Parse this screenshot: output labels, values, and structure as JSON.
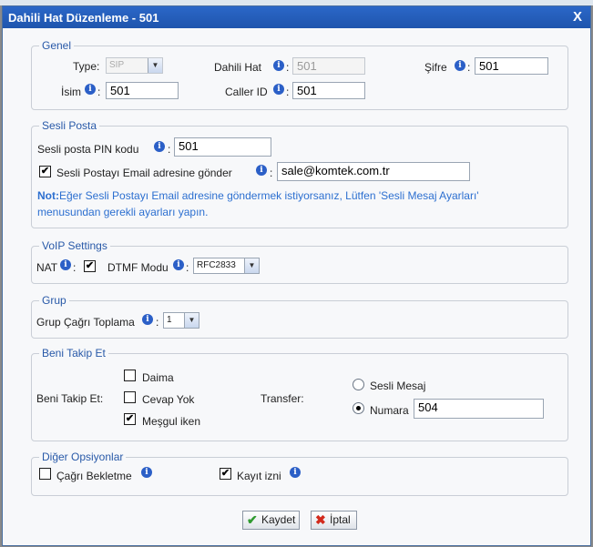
{
  "dialog": {
    "title": "Dahili Hat Düzenleme - 501",
    "close": "X"
  },
  "general": {
    "legend": "Genel",
    "type_label": "Type:",
    "type_value": "SIP",
    "extension_label": "Dahili Hat",
    "extension_value": "501",
    "password_label": "Şifre",
    "password_value": "501",
    "name_label": "İsim",
    "name_value": "501",
    "caller_id_label": "Caller ID",
    "caller_id_value": "501"
  },
  "voicemail": {
    "legend": "Sesli Posta",
    "pin_label": "Sesli posta PIN kodu",
    "pin_value": "501",
    "email_checkbox_label": "Sesli Postayı Email adresine gönder",
    "email_checked": true,
    "email_value": "sale@komtek.com.tr",
    "note_prefix": "Not:",
    "note_line1": "Eğer Sesli Postayı Email adresine göndermek istiyorsanız, Lütfen 'Sesli Mesaj Ayarları'",
    "note_line2": "menusundan gerekli ayarları yapın."
  },
  "voip": {
    "legend": "VoIP Settings",
    "nat_label": "NAT",
    "nat_checked": true,
    "dtmf_label": "DTMF Modu",
    "dtmf_value": "RFC2833"
  },
  "group": {
    "legend": "Grup",
    "pickup_label": "Grup Çağrı Toplama",
    "pickup_value": "1"
  },
  "follow_me": {
    "legend": "Beni Takip Et",
    "label": "Beni Takip Et:",
    "options": [
      {
        "label": "Daima",
        "checked": false
      },
      {
        "label": "Cevap Yok",
        "checked": false
      },
      {
        "label": "Meşgul iken",
        "checked": true
      }
    ],
    "transfer_label": "Transfer:",
    "voicemail_option": "Sesli Mesaj",
    "number_option": "Numara",
    "number_value": "504",
    "selected": "number"
  },
  "other": {
    "legend": "Diğer Opsiyonlar",
    "call_waiting_label": "Çağrı Bekletme",
    "call_waiting_checked": false,
    "record_label": "Kayıt izni",
    "record_checked": true
  },
  "buttons": {
    "save": "Kaydet",
    "cancel": "İptal"
  },
  "icons": {
    "info": "i",
    "check": "✔",
    "cross": "✖"
  },
  "colors": {
    "title_bar": "#2b67c8",
    "legend": "#2859a8",
    "note": "#2c6fd0"
  }
}
